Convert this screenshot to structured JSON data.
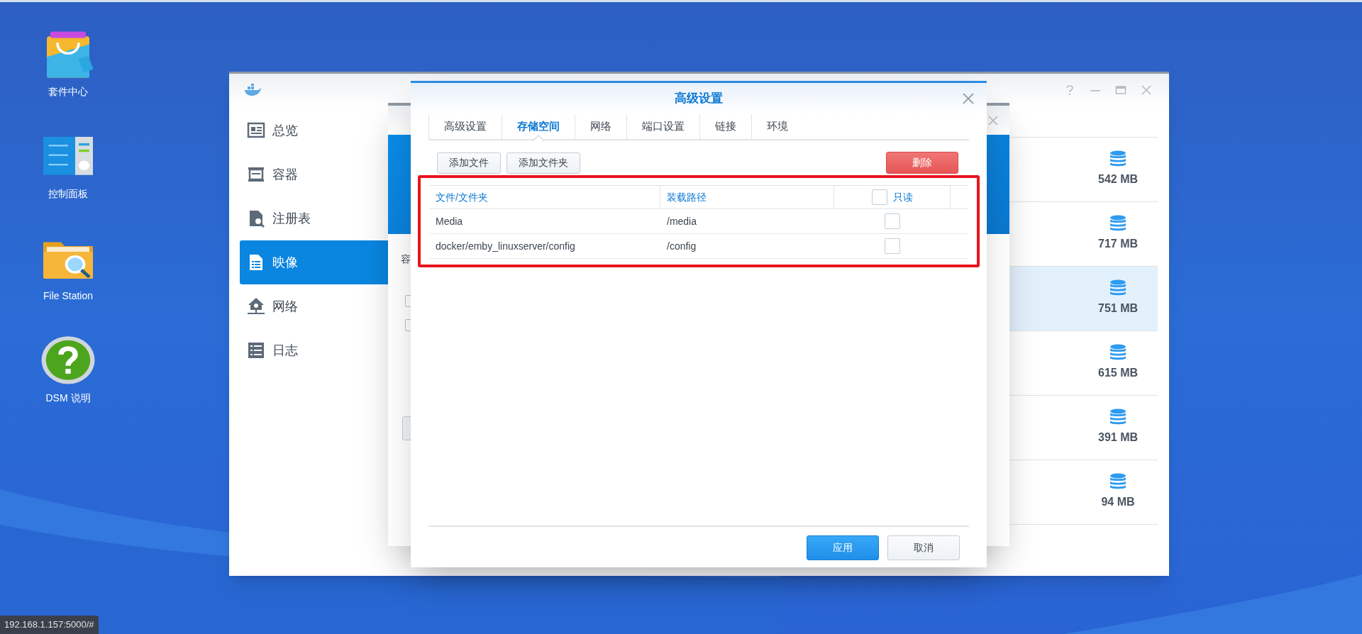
{
  "desktop_icons": [
    {
      "label": "套件中心",
      "kind": "package"
    },
    {
      "label": "控制面板",
      "kind": "control"
    },
    {
      "label": "File Station",
      "kind": "folder"
    },
    {
      "label": "DSM 说明",
      "kind": "help"
    }
  ],
  "docker_window": {
    "sidebar": [
      {
        "label": "总览",
        "kind": "overview",
        "selected": false
      },
      {
        "label": "容器",
        "kind": "container",
        "selected": false
      },
      {
        "label": "注册表",
        "kind": "registry",
        "selected": false
      },
      {
        "label": "映像",
        "kind": "image",
        "selected": true
      },
      {
        "label": "网络",
        "kind": "network",
        "selected": false
      },
      {
        "label": "日志",
        "kind": "log",
        "selected": false
      }
    ],
    "image_sizes": [
      {
        "size": "542 MB",
        "selected": false
      },
      {
        "size": "717 MB",
        "selected": false
      },
      {
        "size": "751 MB",
        "selected": true
      },
      {
        "size": "615 MB",
        "selected": false
      },
      {
        "size": "391 MB",
        "selected": false
      },
      {
        "size": "94 MB",
        "selected": false
      }
    ]
  },
  "background_window": {
    "label": "容",
    "checkboxes": [
      {
        "checked": false
      },
      {
        "checked": false
      }
    ]
  },
  "dialog": {
    "title": "高级设置",
    "tabs": [
      {
        "label": "高级设置",
        "selected": false
      },
      {
        "label": "存储空间",
        "selected": true
      },
      {
        "label": "网络",
        "selected": false
      },
      {
        "label": "端口设置",
        "selected": false
      },
      {
        "label": "链接",
        "selected": false
      },
      {
        "label": "环境",
        "selected": false
      }
    ],
    "add_file": "添加文件",
    "add_folder": "添加文件夹",
    "delete": "删除",
    "highlight": true,
    "table": {
      "columns": [
        "文件/文件夹",
        "装载路径",
        "只读"
      ],
      "readonly_all": false,
      "rows": [
        {
          "path": "Media",
          "mount": "/media",
          "readonly": false
        },
        {
          "path": "docker/emby_linuxserver/config",
          "mount": "/config",
          "readonly": false
        }
      ]
    },
    "apply": "应用",
    "cancel": "取消"
  },
  "status_url": "192.168.1.157:5000/#"
}
